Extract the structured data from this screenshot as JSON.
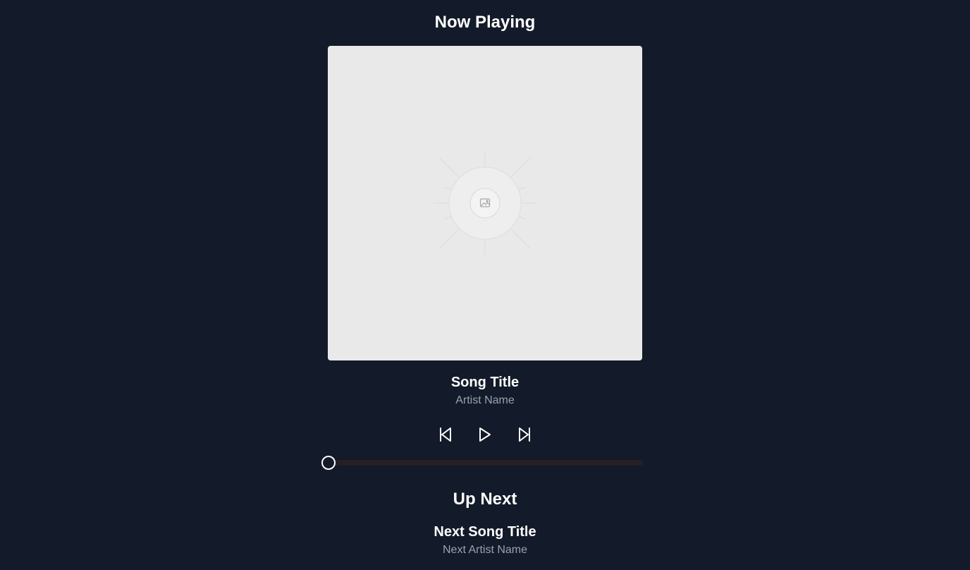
{
  "now_playing": {
    "heading": "Now Playing",
    "album_art_icon": "image-placeholder-icon",
    "song_title": "Song Title",
    "artist_name": "Artist Name"
  },
  "controls": {
    "previous_icon": "skip-previous-icon",
    "play_icon": "play-icon",
    "next_icon": "skip-next-icon"
  },
  "progress": {
    "fraction": 0
  },
  "up_next": {
    "heading": "Up Next",
    "song_title": "Next Song Title",
    "artist_name": "Next Artist Name"
  },
  "colors": {
    "background": "#131a29",
    "text_primary": "#ffffff",
    "text_secondary": "#9aa2b1",
    "art_placeholder": "#e9e9ea",
    "progress_track": "#261f24"
  }
}
